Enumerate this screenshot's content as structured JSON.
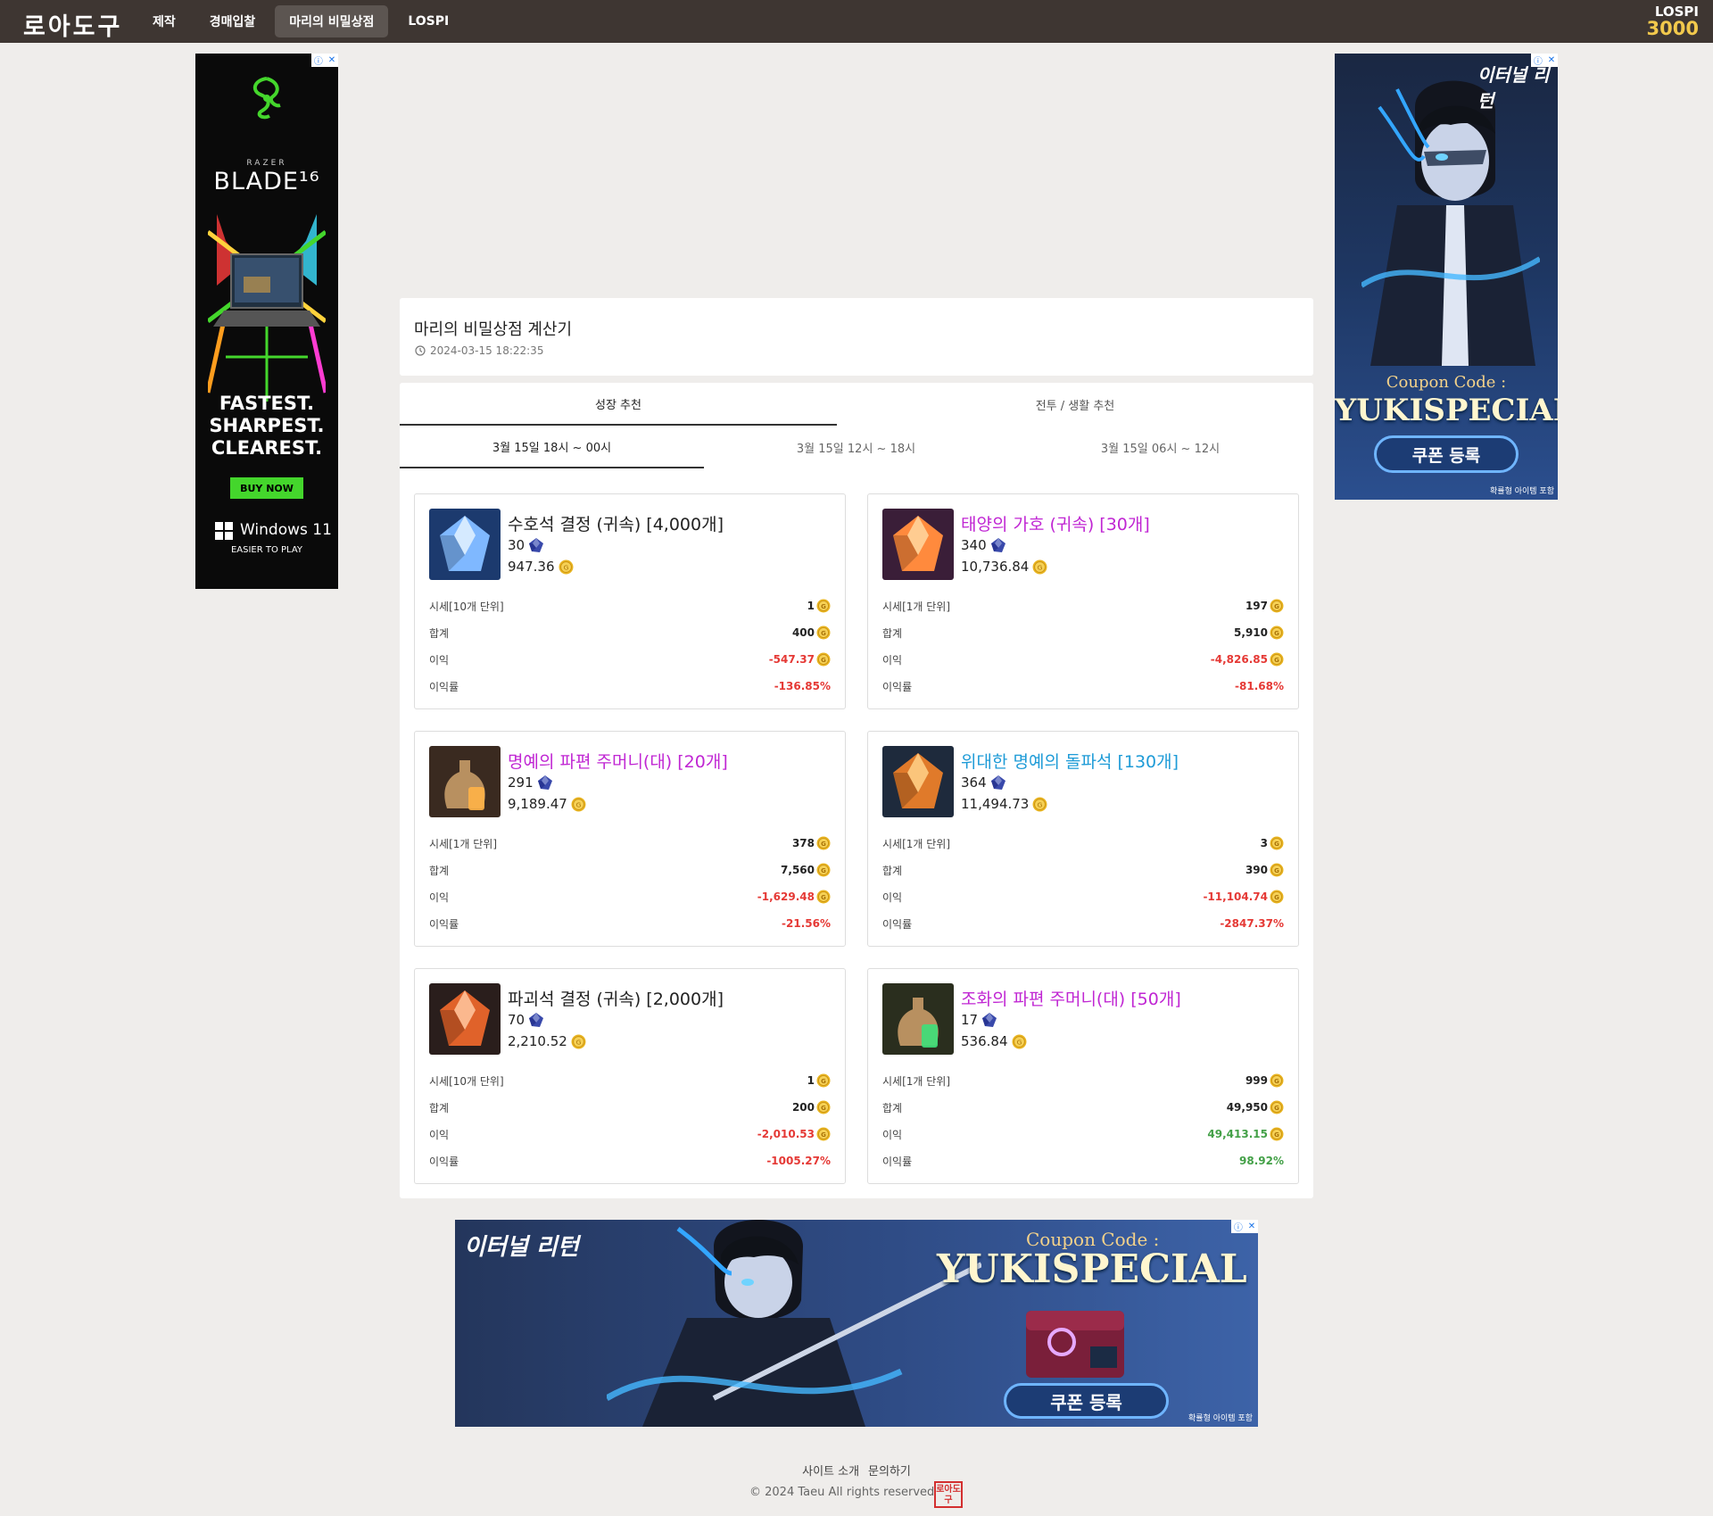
{
  "nav": {
    "logo": "로아도구",
    "items": [
      "제작",
      "경매입찰",
      "마리의 비밀상점",
      "LOSPI"
    ],
    "lospi_label": "LOSPI",
    "lospi_value": "3000"
  },
  "ads": {
    "left": {
      "brand": "RAZER",
      "model": "BLADE¹⁶",
      "tagline": [
        "FASTEST.",
        "SHARPEST.",
        "CLEAREST."
      ],
      "button": "BUY NOW",
      "os": "Windows 11",
      "os_sub": "EASIER TO PLAY"
    },
    "right": {
      "logo": "이터널 리턴",
      "coupon_label": "Coupon Code :",
      "coupon_code": "YUKISPECIAL",
      "button": "쿠폰 등록",
      "fine": "확률형 아이템 포함"
    },
    "bottom": {
      "logo": "이터널 리턴",
      "coupon_label": "Coupon Code :",
      "coupon_code": "YUKISPECIAL",
      "button": "쿠폰 등록",
      "fine": "확률형 아이템 포함"
    }
  },
  "header": {
    "title": "마리의 비밀상점 계산기",
    "timestamp": "2024-03-15 18:22:35"
  },
  "tabs": [
    "성장 추천",
    "전투 / 생활 추천"
  ],
  "subtabs": [
    "3월 15일 18시 ~ 00시",
    "3월 15일 12시 ~ 18시",
    "3월 15일 06시 ~ 12시"
  ],
  "stat_labels": {
    "price_10": "시세[10개 단위]",
    "price_1": "시세[1개 단위]",
    "total": "합계",
    "profit": "이익",
    "rate": "이익률"
  },
  "items": [
    {
      "name": "수호석 결정 (귀속) [4,000개]",
      "name_color": "#222222",
      "crystal": "30",
      "gold": "947.36",
      "price_label": "시세[10개 단위]",
      "price": "1",
      "total": "400",
      "profit": "-547.37",
      "rate": "-136.85%",
      "sign": "neg",
      "icon": "guardian-crystal-icon"
    },
    {
      "name": "태양의 가호 (귀속) [30개]",
      "name_color": "#c026d3",
      "crystal": "340",
      "gold": "10,736.84",
      "price_label": "시세[1개 단위]",
      "price": "197",
      "total": "5,910",
      "profit": "-4,826.85",
      "rate": "-81.68%",
      "sign": "neg",
      "icon": "sun-protection-icon"
    },
    {
      "name": "명예의 파편 주머니(대) [20개]",
      "name_color": "#c026d3",
      "crystal": "291",
      "gold": "9,189.47",
      "price_label": "시세[1개 단위]",
      "price": "378",
      "total": "7,560",
      "profit": "-1,629.48",
      "rate": "-21.56%",
      "sign": "neg",
      "icon": "honor-shard-pouch-icon"
    },
    {
      "name": "위대한 명예의 돌파석 [130개]",
      "name_color": "#1e9bd7",
      "crystal": "364",
      "gold": "11,494.73",
      "price_label": "시세[1개 단위]",
      "price": "3",
      "total": "390",
      "profit": "-11,104.74",
      "rate": "-2847.37%",
      "sign": "neg",
      "icon": "great-honor-leapstone-icon"
    },
    {
      "name": "파괴석 결정 (귀속) [2,000개]",
      "name_color": "#222222",
      "crystal": "70",
      "gold": "2,210.52",
      "price_label": "시세[10개 단위]",
      "price": "1",
      "total": "200",
      "profit": "-2,010.53",
      "rate": "-1005.27%",
      "sign": "neg",
      "icon": "destruction-crystal-icon"
    },
    {
      "name": "조화의 파편 주머니(대) [50개]",
      "name_color": "#c026d3",
      "crystal": "17",
      "gold": "536.84",
      "price_label": "시세[1개 단위]",
      "price": "999",
      "total": "49,950",
      "profit": "49,413.15",
      "rate": "98.92%",
      "sign": "pos",
      "icon": "harmony-shard-pouch-icon"
    }
  ],
  "footer": {
    "links": [
      "사이트 소개",
      "문의하기"
    ],
    "copyright": "© 2024 Taeu All rights reserved",
    "stamp": "로아도구"
  },
  "colors": {
    "nav_bg": "#3e3632",
    "page_bg": "#efedeb",
    "lospi": "#f2c94c",
    "negative": "#e53935",
    "positive": "#43a047"
  }
}
